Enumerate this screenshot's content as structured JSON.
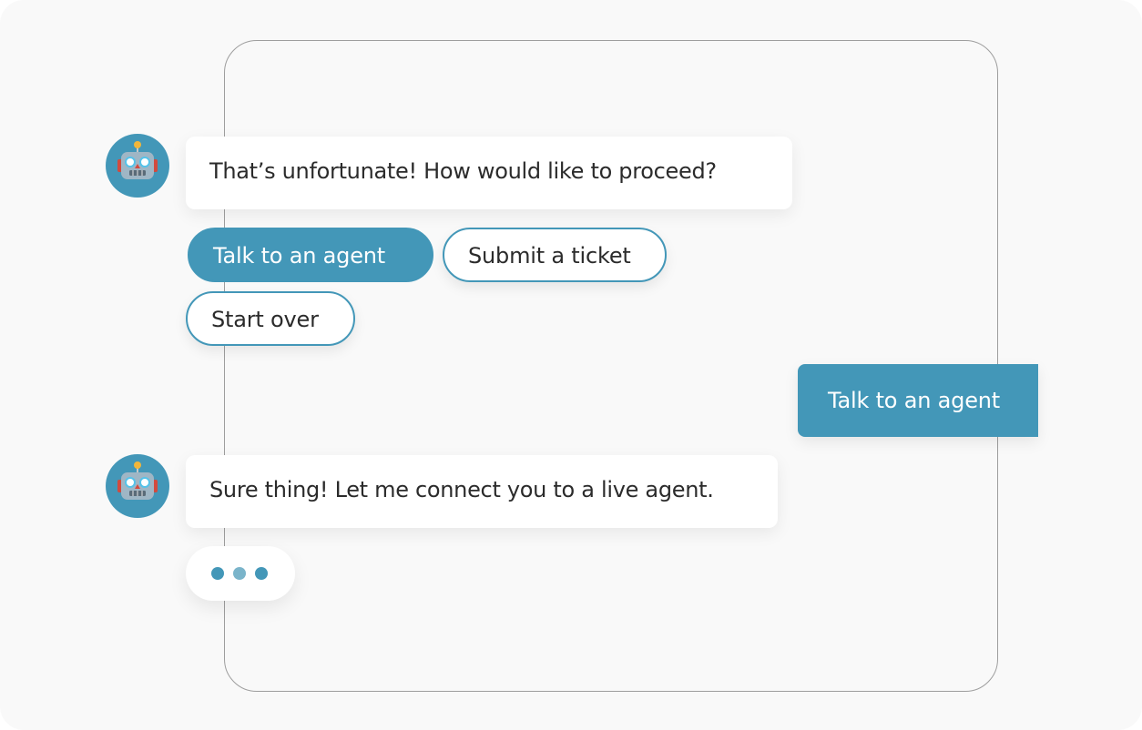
{
  "colors": {
    "accent": "#4397b8",
    "dot_light": "#7ab4ca"
  },
  "messages": {
    "bot_1": {
      "text": "That’s unfortunate! How would like to proceed?",
      "avatar_icon": "robot-icon"
    },
    "quick_replies": [
      "Talk to an agent",
      "Submit a ticket",
      "Start over"
    ],
    "user_1": {
      "text": "Talk to an agent"
    },
    "bot_2": {
      "text": "Sure thing! Let me connect you to a live agent.",
      "avatar_icon": "robot-icon"
    },
    "typing_indicator": {
      "icon": "typing-dots-icon"
    }
  }
}
